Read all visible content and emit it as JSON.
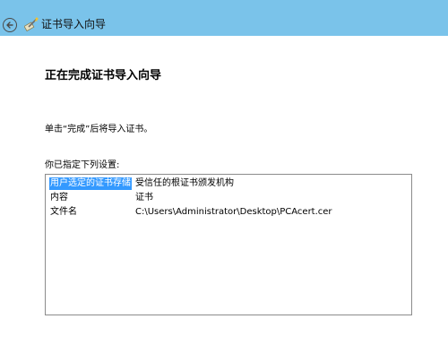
{
  "window": {
    "title": "证书导入向导",
    "back_icon": "back-arrow-icon",
    "wizard_icon": "certificate-wizard-icon",
    "titlebar_color": "#7ac3ea"
  },
  "page": {
    "heading": "正在完成证书导入向导",
    "instruction": "单击“完成”后将导入证书。",
    "settings_label": "你已指定下列设置:"
  },
  "settings": [
    {
      "key": "用户选定的证书存储",
      "value": "受信任的根证书颁发机构",
      "selected": true
    },
    {
      "key": "内容",
      "value": "证书",
      "selected": false
    },
    {
      "key": "文件名",
      "value": "C:\\Users\\Administrator\\Desktop\\PCAcert.cer",
      "selected": false
    }
  ],
  "colors": {
    "selection": "#3399ff"
  }
}
